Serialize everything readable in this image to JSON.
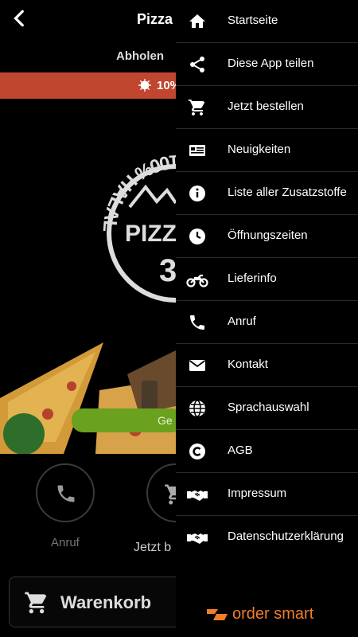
{
  "header": {
    "title": "Pizza I"
  },
  "tabs": {
    "active_label": "Abholen"
  },
  "promo": {
    "text": "10%"
  },
  "hero": {
    "logo_text": "100% HALAL",
    "brand_text": "PIZZA",
    "number": "3",
    "cta_label": "Ge"
  },
  "quick_actions": [
    {
      "label": "Anruf"
    },
    {
      "label": "Jetzt b"
    }
  ],
  "cart": {
    "label": "Warenkorb"
  },
  "drawer": {
    "items": [
      {
        "label": "Startseite",
        "icon": "home-icon"
      },
      {
        "label": "Diese App teilen",
        "icon": "share-icon"
      },
      {
        "label": "Jetzt bestellen",
        "icon": "cart-icon"
      },
      {
        "label": "Neuigkeiten",
        "icon": "news-icon"
      },
      {
        "label": "Liste aller Zusatzstoffe",
        "icon": "info-icon"
      },
      {
        "label": "Öffnungszeiten",
        "icon": "clock-icon"
      },
      {
        "label": "Lieferinfo",
        "icon": "motorcycle-icon"
      },
      {
        "label": "Anruf",
        "icon": "phone-icon"
      },
      {
        "label": "Kontakt",
        "icon": "mail-icon"
      },
      {
        "label": "Sprachauswahl",
        "icon": "globe-icon"
      },
      {
        "label": "AGB",
        "icon": "copyright-icon"
      },
      {
        "label": "Impressum",
        "icon": "handshake-icon"
      },
      {
        "label": "Datenschutzerklärung",
        "icon": "handshake-icon"
      }
    ],
    "brand": "order smart",
    "brand_color": "#f07d2b"
  },
  "colors": {
    "promo_bar": "#c0462f",
    "cta_green": "#6aa11f",
    "background": "#000000"
  }
}
